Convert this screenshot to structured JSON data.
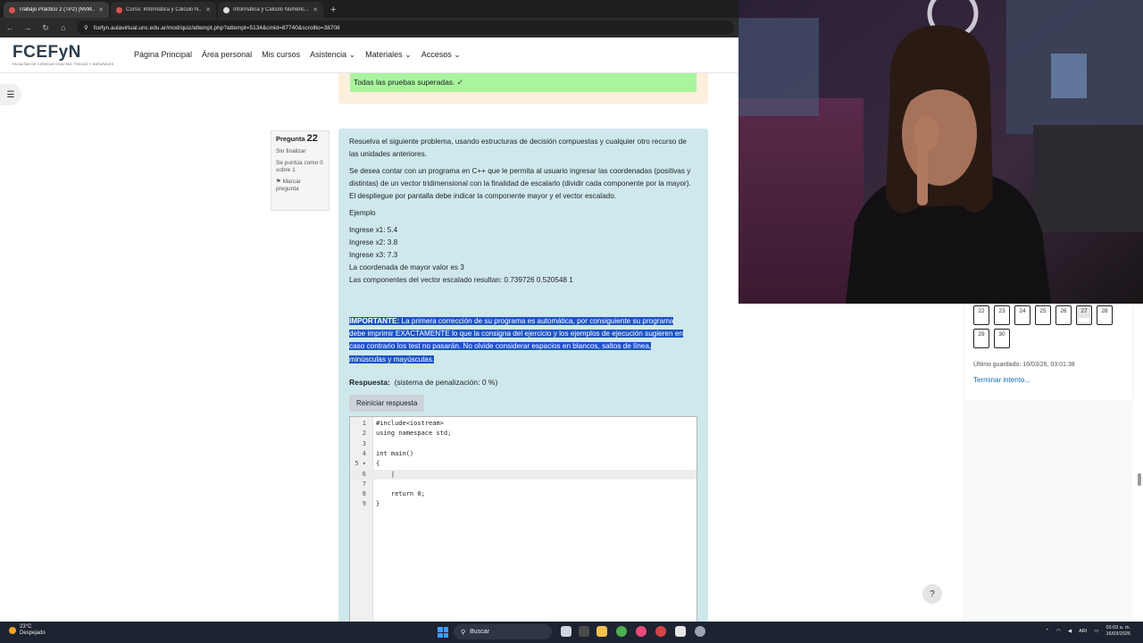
{
  "browser": {
    "tabs": [
      {
        "label": "Trabajo Práctico 2 (TP2) [NVM...",
        "active": true
      },
      {
        "label": "Curso: Informática y Cálculo N...",
        "active": false
      },
      {
        "label": "Informática y Cálculo Numéric...",
        "active": false
      }
    ],
    "url": "fcefyn.aulavirtual.unc.edu.ar/mod/quiz/attempt.php?attempt=5134&cmid=87740&scrollto=38708"
  },
  "site": {
    "logo_main": "FCEFyN",
    "logo_sub": "FACULTAD DE CIENCIAS EXACTAS, FÍSICAS Y NATURALES",
    "nav": [
      "Página Principal",
      "Área personal",
      "Mis cursos",
      "Asistencia ⌄",
      "Materiales ⌄",
      "Accesos ⌄"
    ]
  },
  "previous": {
    "passed_text": "Todas las pruebas superadas. ✓"
  },
  "question": {
    "label_prefix": "Pregunta",
    "number": "22",
    "status": "Sin finalizar",
    "score": "Se puntúa como 0 sobre 1",
    "flag": "⚑ Marcar pregunta",
    "p1": "Resuelva el siguiente problema, usando  estructuras de decisión compuestas y cualquier otro recurso de las unidades anteriores.",
    "p2": "Se desea contar con un programa en C++ que le permita al usuario ingresar las coordenadas (positivas y distintas) de un vector tridimensional con la finalidad de escalarlo (dividir cada componente por la mayor). El despliegue por pantalla debe indicar la componente mayor y el vector escalado.",
    "example_title": "Ejemplo",
    "example_lines": [
      "Ingrese x1: 5.4",
      "Ingrese x2: 3.8",
      "Ingrese x3: 7.3",
      "La coordenada de mayor valor es 3",
      "Las componentes del vector escalado resultan: 0.739726 0.520548 1"
    ],
    "important_label": "IMPORTANTE:",
    "important_text": " La primera corrección de su programa es automática, por consiguiente su programa debe imprimir EXACTAMENTE lo que la consigna del ejercicio y los ejemplos de ejecución sugieren en caso contrario los test no pasarán. No olvide considerar espacios en blancos, saltos de línea, minúsculas y mayúsculas.",
    "answer_label": "Respuesta:",
    "penalty": "(sistema de penalización: 0 %)",
    "reset_label": "Reiniciar respuesta"
  },
  "code": {
    "line_numbers": [
      "1",
      "2",
      "3",
      "4",
      "5 ▾",
      "6",
      "7",
      "8",
      "9"
    ],
    "lines": [
      "#include<iostream>",
      "using namespace std;",
      "",
      "int main()",
      "{",
      "    |",
      "",
      "    return 0;",
      "}"
    ],
    "active_line": 6
  },
  "quiz_nav": {
    "buttons": [
      "22",
      "23",
      "24",
      "25",
      "26",
      "27",
      "28",
      "29",
      "30"
    ],
    "current": "27",
    "last_saved": "Último guardado: 16/03/26, 03:01:38",
    "finish": "Terminar intento..."
  },
  "help_label": "?",
  "taskbar": {
    "weather_temp": "23°C",
    "weather_desc": "Despejado",
    "search": "Buscar",
    "lang": "ARI",
    "time": "03:03 a. m.",
    "date": "16/03/2026"
  },
  "colors": {
    "question_bg": "#cfe8ec",
    "passed_bg": "#a8f59e",
    "selection": "#1c54c4",
    "link": "#0f6cbf"
  }
}
